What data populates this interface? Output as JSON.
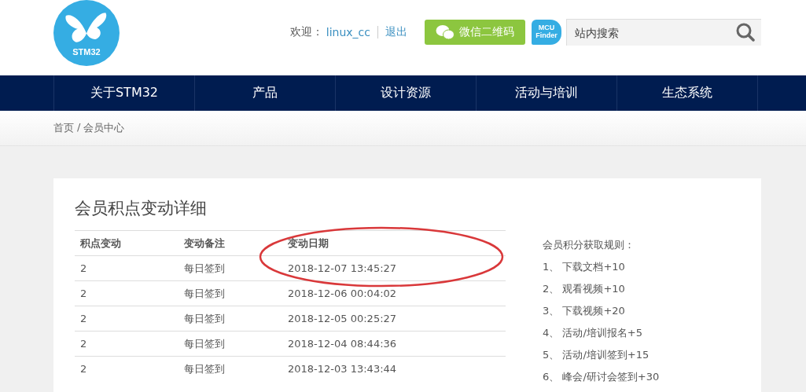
{
  "header": {
    "logo_text": "STM32",
    "welcome_label": "欢迎：",
    "username": "linux_cc",
    "logout": "退出",
    "wechat_button": "微信二维码",
    "mcu_finder": {
      "line1": "MCU",
      "line2": "Finder"
    },
    "search": {
      "placeholder": "站内搜索"
    }
  },
  "nav": [
    {
      "label": "关于STM32"
    },
    {
      "label": "产品"
    },
    {
      "label": "设计资源"
    },
    {
      "label": "活动与培训"
    },
    {
      "label": "生态系统"
    }
  ],
  "breadcrumb": {
    "home": "首页",
    "separator": "/",
    "current": "会员中心"
  },
  "panel": {
    "title": "会员积点变动详细",
    "table": {
      "columns": [
        "积点变动",
        "变动备注",
        "变动日期"
      ],
      "rows": [
        [
          "2",
          "每日签到",
          "2018-12-07 13:45:27"
        ],
        [
          "2",
          "每日签到",
          "2018-12-06 00:04:02"
        ],
        [
          "2",
          "每日签到",
          "2018-12-05 00:25:27"
        ],
        [
          "2",
          "每日签到",
          "2018-12-04 08:44:36"
        ],
        [
          "2",
          "每日签到",
          "2018-12-03 13:43:44"
        ]
      ]
    },
    "rules": {
      "title": "会员积分获取规则：",
      "items": [
        "1、 下载文档+10",
        "2、 观看视频+10",
        "3、 下载视频+20",
        "4、 活动/培训报名+5",
        "5、 活动/培训签到+15",
        "6、 峰会/研讨会签到+30"
      ]
    }
  }
}
